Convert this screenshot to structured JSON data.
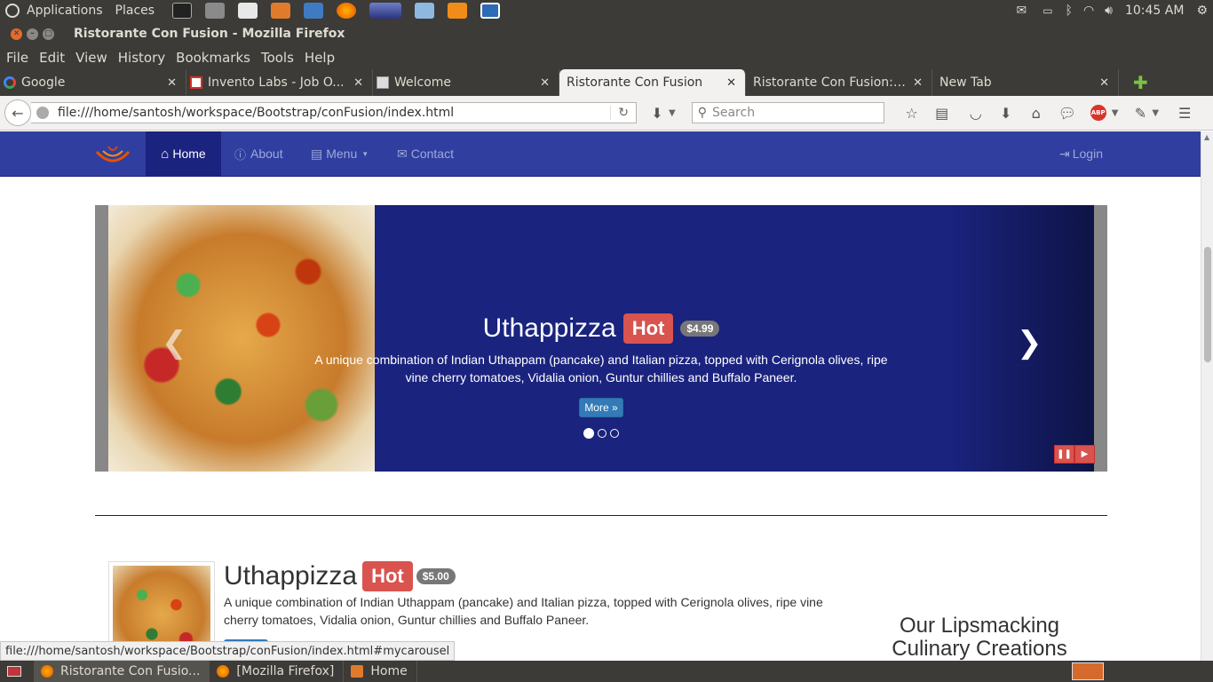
{
  "panel": {
    "applications": "Applications",
    "places": "Places",
    "time": "10:45 AM"
  },
  "window": {
    "title": "Ristorante Con Fusion - Mozilla Firefox"
  },
  "menu": [
    "File",
    "Edit",
    "View",
    "History",
    "Bookmarks",
    "Tools",
    "Help"
  ],
  "tabs": [
    {
      "label": "Google",
      "favicon": "google-icon"
    },
    {
      "label": "Invento Labs - Job O...",
      "favicon": "gmail-icon"
    },
    {
      "label": "Welcome",
      "favicon": "page-icon"
    },
    {
      "label": "Ristorante Con Fusion",
      "favicon": "none",
      "active": true
    },
    {
      "label": "Ristorante Con Fusion: ...",
      "favicon": "none"
    },
    {
      "label": "New Tab",
      "favicon": "none"
    }
  ],
  "toolbar": {
    "url": "file:///home/santosh/workspace/Bootstrap/conFusion/index.html",
    "search_placeholder": "Search"
  },
  "site_nav": {
    "home": "Home",
    "about": "About",
    "menu": "Menu",
    "contact": "Contact",
    "login": "Login"
  },
  "carousel": {
    "title": "Uthappizza",
    "hot_label": "Hot",
    "price": "$4.99",
    "description": "A unique combination of Indian Uthappam (pancake) and Italian pizza, topped with Cerignola olives, ripe vine cherry tomatoes, Vidalia onion, Guntur chillies and Buffalo Paneer.",
    "more_button": "More »",
    "prev_icon": "‹",
    "next_icon": "›",
    "active_slide": 1,
    "slide_count": 3
  },
  "media": {
    "title": "Uthappizza",
    "hot_label": "Hot",
    "price": "$5.00",
    "description": "A unique combination of Indian Uthappam (pancake) and Italian pizza, topped with Cerignola olives, ripe vine cherry tomatoes, Vidalia onion, Guntur chillies and Buffalo Paneer."
  },
  "aside": {
    "heading_line1": "Our Lipsmacking",
    "heading_line2": "Culinary Creations"
  },
  "status_url": "file:///home/santosh/workspace/Bootstrap/conFusion/index.html#mycarousel",
  "taskbar": [
    {
      "label": "Ristorante Con Fusio...",
      "icon": "firefox-icon"
    },
    {
      "label": "[Mozilla Firefox]",
      "icon": "firefox-icon"
    },
    {
      "label": "Home",
      "icon": "folder-icon"
    }
  ],
  "colors": {
    "brand_primary": "#303f9f",
    "brand_dark": "#1a237e",
    "hot": "#d9534f",
    "more_button": "#337ab7"
  }
}
